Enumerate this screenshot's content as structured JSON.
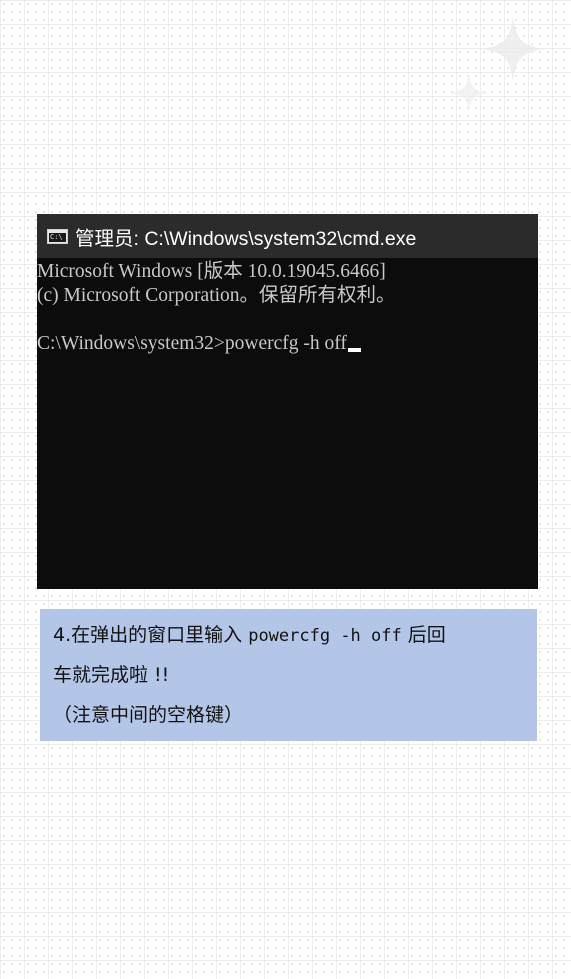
{
  "cmd_window": {
    "icon_label": "C:\\",
    "title": "管理员: C:\\Windows\\system32\\cmd.exe",
    "lines": [
      "Microsoft Windows [版本 10.0.19045.6466]",
      "(c) Microsoft Corporation。保留所有权利。",
      "",
      "C:\\Windows\\system32>powercfg -h off"
    ]
  },
  "instruction": {
    "step": "4.",
    "text_before_cmd": "在弹出的窗口里输入",
    "command": "powercfg -h off",
    "text_after_cmd": "后回",
    "line2": "车就完成啦 !!",
    "line3": "（注意中间的空格键）"
  },
  "colors": {
    "terminal_bg": "#0c0c0c",
    "titlebar_bg": "#2b2b2b",
    "terminal_text": "#c8c8c8",
    "instruction_bg": "#b4c6e7"
  }
}
